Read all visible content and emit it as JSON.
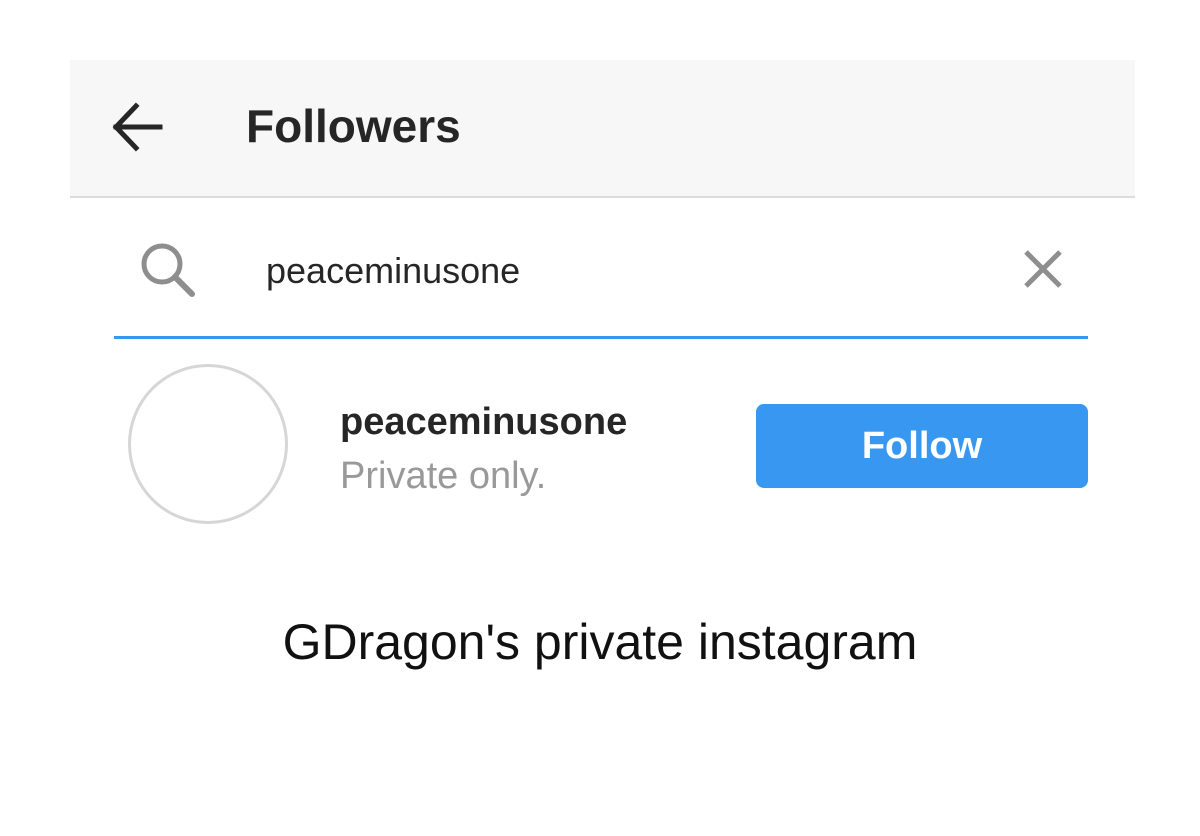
{
  "header": {
    "back_icon": "arrow-left-icon",
    "title": "Followers"
  },
  "search": {
    "icon": "search-icon",
    "value": "peaceminusone",
    "clear_icon": "close-icon",
    "underline_color": "#3897f0"
  },
  "results": [
    {
      "username": "peaceminusone",
      "subtitle": "Private only.",
      "follow_label": "Follow"
    }
  ],
  "caption": "GDragon's private instagram",
  "colors": {
    "accent": "#3897f0",
    "text_primary": "#262626",
    "text_secondary": "#999999",
    "header_bg": "#f7f7f7"
  }
}
